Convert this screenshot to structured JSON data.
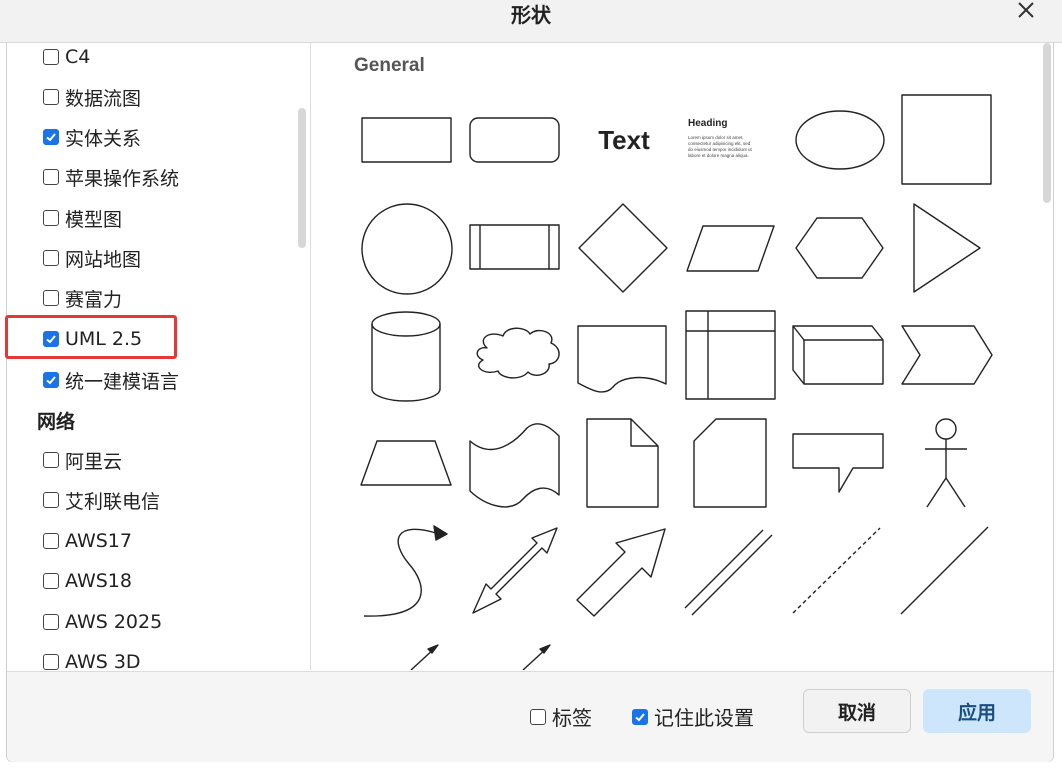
{
  "dialog": {
    "title": "形状"
  },
  "sidebar": {
    "items": [
      {
        "label": "C4",
        "checked": false
      },
      {
        "label": "数据流图",
        "checked": false
      },
      {
        "label": "实体关系",
        "checked": true
      },
      {
        "label": "苹果操作系统",
        "checked": false
      },
      {
        "label": "模型图",
        "checked": false
      },
      {
        "label": "网站地图",
        "checked": false
      },
      {
        "label": "赛富力",
        "checked": false
      },
      {
        "label": "UML 2.5",
        "checked": true
      },
      {
        "label": "统一建模语言",
        "checked": true
      }
    ],
    "section_network": "网络",
    "network_items": [
      {
        "label": "阿里云",
        "checked": false
      },
      {
        "label": "艾利联电信",
        "checked": false
      },
      {
        "label": "AWS17",
        "checked": false
      },
      {
        "label": "AWS18",
        "checked": false
      },
      {
        "label": "AWS 2025",
        "checked": false
      },
      {
        "label": "AWS 3D",
        "checked": false
      }
    ]
  },
  "content": {
    "section_title": "General",
    "text_shape_label": "Text",
    "heading_shape_title": "Heading",
    "heading_shape_body": [
      "Lorem ipsum dolor sit amet,",
      "consectetur adipisicing elit, sed",
      "do eiusmod tempor incididunt ut",
      "labore et dolore magna aliqua."
    ]
  },
  "footer": {
    "labels_option": {
      "label": "标签",
      "checked": false
    },
    "remember_option": {
      "label": "记住此设置",
      "checked": true
    },
    "cancel_label": "取消",
    "apply_label": "应用"
  },
  "colors": {
    "accent": "#1a73e8",
    "highlight": "#e53935",
    "apply_bg": "#cde6fb"
  }
}
